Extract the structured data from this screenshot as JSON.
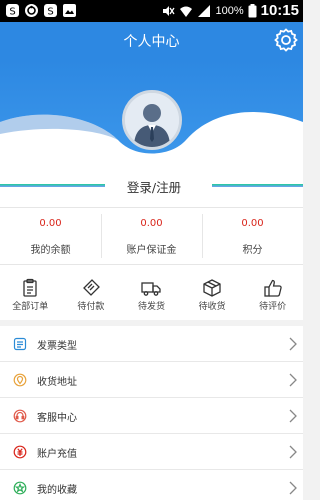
{
  "status_bar": {
    "battery": "100%",
    "time": "10:15"
  },
  "header": {
    "title": "个人中心"
  },
  "profile": {
    "login_label": "登录/注册"
  },
  "stats": [
    {
      "value": "0.00",
      "label": "我的余额"
    },
    {
      "value": "0.00",
      "label": "账户保证金"
    },
    {
      "value": "0.00",
      "label": "积分"
    }
  ],
  "orders": [
    {
      "label": "全部订单",
      "icon": "clipboard-icon"
    },
    {
      "label": "待付款",
      "icon": "payment-icon"
    },
    {
      "label": "待发货",
      "icon": "truck-icon"
    },
    {
      "label": "待收货",
      "icon": "package-icon"
    },
    {
      "label": "待评价",
      "icon": "thumbs-up-icon"
    }
  ],
  "menu": [
    {
      "label": "发票类型",
      "icon": "invoice-icon",
      "color": "#2a8bd6"
    },
    {
      "label": "收货地址",
      "icon": "location-icon",
      "color": "#e8a23a"
    },
    {
      "label": "客服中心",
      "icon": "headset-icon",
      "color": "#e05a4a"
    },
    {
      "label": "账户充值",
      "icon": "recharge-icon",
      "color": "#d9261c"
    },
    {
      "label": "我的收藏",
      "icon": "favorite-icon",
      "color": "#2fae5a"
    }
  ],
  "colors": {
    "primary": "#2d88e2",
    "accent_red": "#d9261c",
    "deco_green": "#2ec6a8"
  }
}
